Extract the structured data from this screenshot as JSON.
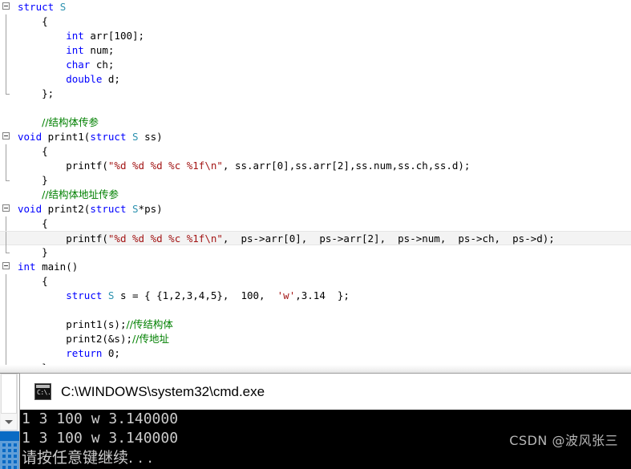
{
  "editor": {
    "name": "visual-studio-code-editor",
    "lines": [
      {
        "id": "l1",
        "fold": "start",
        "indent": 0,
        "tokens": [
          {
            "t": "kw",
            "v": "struct"
          },
          {
            "t": "plain",
            "v": " "
          },
          {
            "t": "type",
            "v": "S"
          }
        ]
      },
      {
        "id": "l2",
        "fold": "bar",
        "indent": 1,
        "tokens": [
          {
            "t": "pun",
            "v": "{"
          }
        ]
      },
      {
        "id": "l3",
        "fold": "bar",
        "indent": 2,
        "tokens": [
          {
            "t": "kw",
            "v": "int"
          },
          {
            "t": "plain",
            "v": " arr[100];"
          }
        ]
      },
      {
        "id": "l4",
        "fold": "bar",
        "indent": 2,
        "tokens": [
          {
            "t": "kw",
            "v": "int"
          },
          {
            "t": "plain",
            "v": " num;"
          }
        ]
      },
      {
        "id": "l5",
        "fold": "bar",
        "indent": 2,
        "tokens": [
          {
            "t": "kw",
            "v": "char"
          },
          {
            "t": "plain",
            "v": " ch;"
          }
        ]
      },
      {
        "id": "l6",
        "fold": "bar",
        "indent": 2,
        "tokens": [
          {
            "t": "kw",
            "v": "double"
          },
          {
            "t": "plain",
            "v": " d;"
          }
        ]
      },
      {
        "id": "l7",
        "fold": "end",
        "indent": 1,
        "tokens": [
          {
            "t": "pun",
            "v": "};"
          }
        ]
      },
      {
        "id": "l8",
        "fold": "none",
        "indent": 0,
        "tokens": []
      },
      {
        "id": "l9",
        "fold": "none",
        "indent": 1,
        "tokens": [
          {
            "t": "cmt",
            "v": "//结构体传参"
          }
        ]
      },
      {
        "id": "l10",
        "fold": "start",
        "indent": 0,
        "tokens": [
          {
            "t": "kw",
            "v": "void"
          },
          {
            "t": "plain",
            "v": " print1("
          },
          {
            "t": "kw",
            "v": "struct"
          },
          {
            "t": "plain",
            "v": " "
          },
          {
            "t": "type",
            "v": "S"
          },
          {
            "t": "plain",
            "v": " ss)"
          }
        ]
      },
      {
        "id": "l11",
        "fold": "bar",
        "indent": 1,
        "tokens": [
          {
            "t": "pun",
            "v": "{"
          }
        ]
      },
      {
        "id": "l12",
        "fold": "bar",
        "indent": 2,
        "tokens": [
          {
            "t": "plain",
            "v": "printf("
          },
          {
            "t": "str",
            "v": "\"%d %d %d %c %1f\\n\""
          },
          {
            "t": "plain",
            "v": ", ss.arr[0],ss.arr[2],ss.num,ss.ch,ss.d);"
          }
        ]
      },
      {
        "id": "l13",
        "fold": "end",
        "indent": 1,
        "tokens": [
          {
            "t": "pun",
            "v": "}"
          }
        ]
      },
      {
        "id": "l14",
        "fold": "none",
        "indent": 1,
        "tokens": [
          {
            "t": "cmt",
            "v": "//结构体地址传参"
          }
        ]
      },
      {
        "id": "l15",
        "fold": "start",
        "indent": 0,
        "tokens": [
          {
            "t": "kw",
            "v": "void"
          },
          {
            "t": "plain",
            "v": " print2("
          },
          {
            "t": "kw",
            "v": "struct"
          },
          {
            "t": "plain",
            "v": " "
          },
          {
            "t": "type",
            "v": "S"
          },
          {
            "t": "plain",
            "v": "*ps)"
          }
        ]
      },
      {
        "id": "l16",
        "fold": "bar",
        "indent": 1,
        "tokens": [
          {
            "t": "pun",
            "v": "{"
          }
        ]
      },
      {
        "id": "l17",
        "fold": "bar",
        "indent": 2,
        "highlight": true,
        "tokens": [
          {
            "t": "plain",
            "v": "printf("
          },
          {
            "t": "str",
            "v": "\"%d %d %d %c %1f\\n\""
          },
          {
            "t": "plain",
            "v": ",  ps->arr[0],  ps->arr[2],  ps->num,  ps->ch,  ps->d);"
          }
        ]
      },
      {
        "id": "l18",
        "fold": "end",
        "indent": 1,
        "tokens": [
          {
            "t": "pun",
            "v": "}"
          }
        ]
      },
      {
        "id": "l19",
        "fold": "start",
        "indent": 0,
        "tokens": [
          {
            "t": "kw",
            "v": "int"
          },
          {
            "t": "plain",
            "v": " main()"
          }
        ]
      },
      {
        "id": "l20",
        "fold": "bar",
        "indent": 1,
        "tokens": [
          {
            "t": "pun",
            "v": "{"
          }
        ]
      },
      {
        "id": "l21",
        "fold": "bar",
        "indent": 2,
        "tokens": [
          {
            "t": "kw",
            "v": "struct"
          },
          {
            "t": "plain",
            "v": " "
          },
          {
            "t": "type",
            "v": "S"
          },
          {
            "t": "plain",
            "v": " s = { {1,2,3,4,5},  100,  "
          },
          {
            "t": "str",
            "v": "'w'"
          },
          {
            "t": "plain",
            "v": ",3.14  };"
          }
        ]
      },
      {
        "id": "l22",
        "fold": "bar",
        "indent": 0,
        "tokens": []
      },
      {
        "id": "l23",
        "fold": "bar",
        "indent": 2,
        "tokens": [
          {
            "t": "plain",
            "v": "print1(s);"
          },
          {
            "t": "cmt",
            "v": "//传结构体"
          }
        ]
      },
      {
        "id": "l24",
        "fold": "bar",
        "indent": 2,
        "tokens": [
          {
            "t": "plain",
            "v": "print2(&s);"
          },
          {
            "t": "cmt",
            "v": "//传地址"
          }
        ]
      },
      {
        "id": "l25",
        "fold": "bar",
        "indent": 2,
        "tokens": [
          {
            "t": "kw",
            "v": "return"
          },
          {
            "t": "plain",
            "v": " 0;"
          }
        ]
      },
      {
        "id": "l26",
        "fold": "end",
        "indent": 1,
        "tokens": [
          {
            "t": "pun",
            "v": "}"
          }
        ]
      }
    ]
  },
  "scrollbar": {
    "down_arrow_name": "scroll-down-arrow"
  },
  "console": {
    "title": "C:\\WINDOWS\\system32\\cmd.exe",
    "icon_glyph": "C:\\.",
    "output": [
      {
        "text": "1 3 100 w 3.140000",
        "cjk": false
      },
      {
        "text": "1 3 100 w 3.140000",
        "cjk": false
      },
      {
        "text": "请按任意键继续. . .",
        "cjk": true
      }
    ]
  },
  "watermark": {
    "text": "CSDN @波风张三"
  }
}
